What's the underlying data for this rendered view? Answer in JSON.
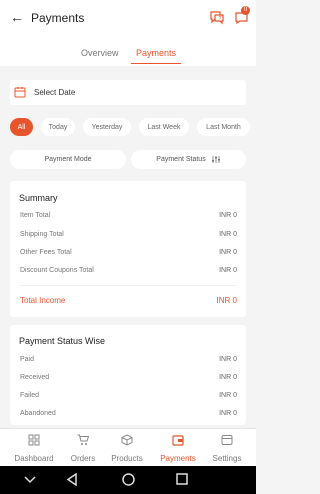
{
  "header": {
    "title": "Payments",
    "badge_count": "0"
  },
  "tabs": [
    {
      "label": "Overview"
    },
    {
      "label": "Payments"
    }
  ],
  "date_picker": {
    "label": "Select Date"
  },
  "date_chips": [
    {
      "label": "All"
    },
    {
      "label": "Today"
    },
    {
      "label": "Yesterday"
    },
    {
      "label": "Last Week"
    },
    {
      "label": "Last Month"
    }
  ],
  "filters": {
    "payment_mode": "Payment Mode",
    "payment_status": "Payment Status"
  },
  "summary": {
    "title": "Summary",
    "rows": [
      {
        "label": "Item Total",
        "value": "INR 0"
      },
      {
        "label": "Shipping Total",
        "value": "INR 0"
      },
      {
        "label": "Other Fees Total",
        "value": "INR 0"
      },
      {
        "label": "Discount Coupons Total",
        "value": "INR 0"
      }
    ],
    "total_label": "Total Income",
    "total_value": "INR 0"
  },
  "status_wise": {
    "title": "Payment Status Wise",
    "rows": [
      {
        "label": "Paid",
        "value": "INR 0"
      },
      {
        "label": "Received",
        "value": "INR 0"
      },
      {
        "label": "Failed",
        "value": "INR 0"
      },
      {
        "label": "Abandoned",
        "value": "INR 0"
      }
    ]
  },
  "bottom_nav": [
    {
      "label": "Dashboard",
      "icon": "dashboard-icon"
    },
    {
      "label": "Orders",
      "icon": "cart-icon"
    },
    {
      "label": "Products",
      "icon": "box-icon"
    },
    {
      "label": "Payments",
      "icon": "wallet-icon"
    },
    {
      "label": "Settings",
      "icon": "settings-icon"
    }
  ],
  "colors": {
    "accent": "#e8542b"
  }
}
